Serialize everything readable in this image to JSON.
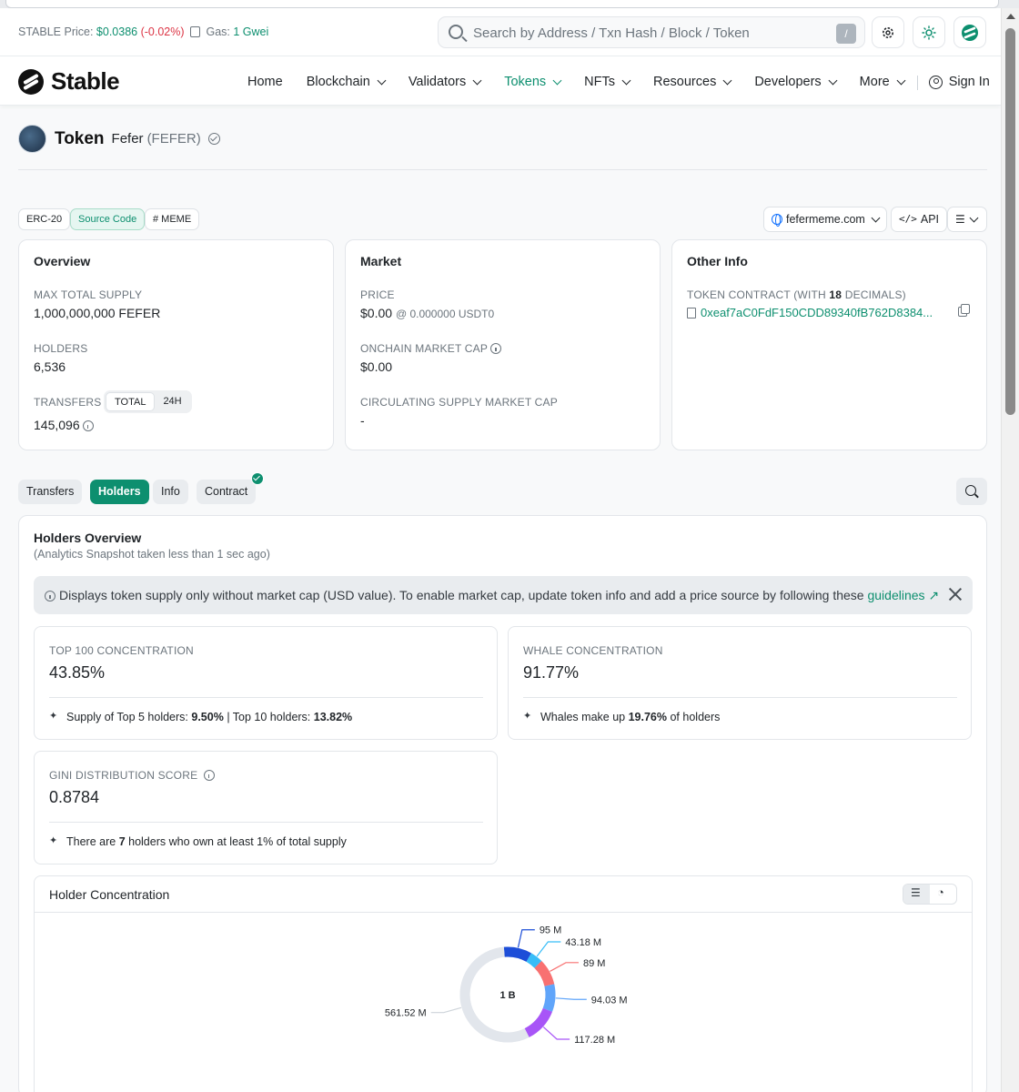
{
  "topbar": {
    "price_label": "STABLE Price:",
    "price_value": "$0.0386",
    "price_change": "(-0.02%)",
    "gas_label": "Gas:",
    "gas_value": "1 Gwei",
    "search_placeholder": "Search by Address / Txn Hash / Block / Token",
    "search_shortcut": "/"
  },
  "nav": {
    "brand": "Stable",
    "items": [
      {
        "label": "Home",
        "dropdown": false
      },
      {
        "label": "Blockchain",
        "dropdown": true
      },
      {
        "label": "Validators",
        "dropdown": true
      },
      {
        "label": "Tokens",
        "dropdown": true,
        "active": true
      },
      {
        "label": "NFTs",
        "dropdown": true
      },
      {
        "label": "Resources",
        "dropdown": true
      },
      {
        "label": "Developers",
        "dropdown": true
      },
      {
        "label": "More",
        "dropdown": true
      }
    ],
    "signin": "Sign In"
  },
  "token": {
    "title": "Token",
    "name": "Fefer",
    "symbol": "(FEFER)"
  },
  "badges": {
    "standard": "ERC-20",
    "source": "Source Code",
    "tag": "# MEME",
    "website": "fefermeme.com",
    "api": "API"
  },
  "overview": {
    "title": "Overview",
    "max_supply_label": "MAX TOTAL SUPPLY",
    "max_supply": "1,000,000,000 FEFER",
    "holders_label": "HOLDERS",
    "holders": "6,536",
    "transfers_label": "TRANSFERS",
    "transfers_seg_total": "TOTAL",
    "transfers_seg_24h": "24H",
    "transfers": "145,096"
  },
  "market": {
    "title": "Market",
    "price_label": "PRICE",
    "price": "$0.00",
    "price_alt": "@ 0.000000 USDT0",
    "mcap_label": "ONCHAIN MARKET CAP",
    "mcap": "$0.00",
    "circ_label": "CIRCULATING SUPPLY MARKET CAP",
    "circ": "-"
  },
  "other": {
    "title": "Other Info",
    "contract_label_pre": "TOKEN CONTRACT (WITH ",
    "contract_decimals": "18",
    "contract_label_post": " DECIMALS)",
    "contract": "0xeaf7aC0FdF150CDD89340fB762D8384..."
  },
  "tabs": [
    "Transfers",
    "Holders",
    "Info",
    "Contract"
  ],
  "holders": {
    "title": "Holders Overview",
    "subtitle": "(Analytics Snapshot taken less than 1 sec ago)",
    "alert": "Displays token supply only without market cap (USD value). To enable market cap, update token info and add a price source by following these",
    "alert_link": "guidelines",
    "top100_label": "TOP 100 CONCENTRATION",
    "top100": "43.85%",
    "top100_note_a": "Supply of Top 5 holders:",
    "top100_note_b": "9.50%",
    "top100_note_c": "| Top 10 holders:",
    "top100_note_d": "13.82%",
    "whale_label": "WHALE CONCENTRATION",
    "whale": "91.77%",
    "whale_note_a": "Whales make up",
    "whale_note_b": "19.76%",
    "whale_note_c": "of holders",
    "gini_label": "GINI DISTRIBUTION SCORE",
    "gini": "0.8784",
    "gini_note_a": "There are",
    "gini_note_b": "7",
    "gini_note_c": "holders who own at least 1% of total supply",
    "concentration_title": "Holder Concentration"
  },
  "chart_data": {
    "type": "pie",
    "center_label": "1 B",
    "slices": [
      {
        "label": "95 M",
        "value": 95,
        "color": "#1d4ed8"
      },
      {
        "label": "43.18 M",
        "value": 43.18,
        "color": "#38bdf8"
      },
      {
        "label": "89 M",
        "value": 89,
        "color": "#f87171"
      },
      {
        "label": "94.03 M",
        "value": 94.03,
        "color": "#60a5fa"
      },
      {
        "label": "117.28 M",
        "value": 117.28,
        "color": "#a855f7"
      },
      {
        "label": "561.52 M",
        "value": 561.52,
        "color": "#e2e6ec"
      }
    ]
  },
  "colors": {
    "accent": "#0d8f6f",
    "negative": "#dc3545"
  }
}
